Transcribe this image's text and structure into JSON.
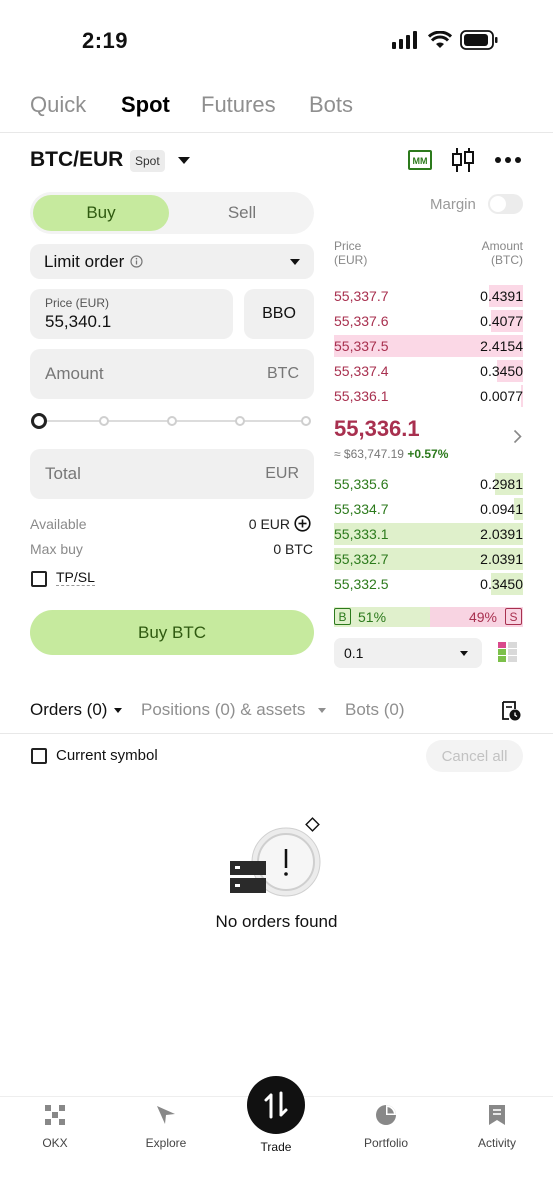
{
  "status_bar": {
    "time": "2:19"
  },
  "top_tabs": [
    {
      "label": "Quick"
    },
    {
      "label": "Spot"
    },
    {
      "label": "Futures"
    },
    {
      "label": "Bots"
    }
  ],
  "pair": {
    "name": "BTC/EUR",
    "badge": "Spot"
  },
  "order_form": {
    "buy_label": "Buy",
    "sell_label": "Sell",
    "order_type": "Limit order",
    "price_label": "Price (EUR)",
    "price_value": "55,340.1",
    "bbo_label": "BBO",
    "amount_placeholder": "Amount",
    "amount_unit": "BTC",
    "total_placeholder": "Total",
    "total_unit": "EUR",
    "available_label": "Available",
    "available_value": "0 EUR",
    "max_buy_label": "Max buy",
    "max_buy_value": "0 BTC",
    "tpsl_label": "TP/SL",
    "buy_button": "Buy BTC"
  },
  "order_book": {
    "margin_label": "Margin",
    "price_header": "Price\n(EUR)",
    "amount_header": "Amount\n(BTC)",
    "asks": [
      {
        "price": "55,337.7",
        "amount": "0.4391",
        "depth": 0.18
      },
      {
        "price": "55,337.6",
        "amount": "0.4077",
        "depth": 0.17
      },
      {
        "price": "55,337.5",
        "amount": "2.4154",
        "depth": 1.0
      },
      {
        "price": "55,337.4",
        "amount": "0.3450",
        "depth": 0.14
      },
      {
        "price": "55,336.1",
        "amount": "0.0077",
        "depth": 0.01
      }
    ],
    "mid_price": "55,336.1",
    "mid_fiat": "≈ $63,747.19",
    "mid_change": "+0.57%",
    "bids": [
      {
        "price": "55,335.6",
        "amount": "0.2981",
        "depth": 0.15
      },
      {
        "price": "55,334.7",
        "amount": "0.0941",
        "depth": 0.05
      },
      {
        "price": "55,333.1",
        "amount": "2.0391",
        "depth": 1.0
      },
      {
        "price": "55,332.7",
        "amount": "2.0391",
        "depth": 1.0
      },
      {
        "price": "55,332.5",
        "amount": "0.3450",
        "depth": 0.17
      }
    ],
    "buy_ratio_letter": "B",
    "buy_ratio": "51%",
    "sell_ratio": "49%",
    "sell_ratio_letter": "S",
    "precision": "0.1"
  },
  "orders_section": {
    "tabs": [
      {
        "label": "Orders (0)"
      },
      {
        "label": "Positions (0) & assets"
      },
      {
        "label": "Bots (0)"
      }
    ],
    "current_symbol_label": "Current symbol",
    "cancel_all_label": "Cancel all",
    "empty_text": "No orders found"
  },
  "bottom_nav": [
    {
      "label": "OKX",
      "icon": "okx-logo-icon"
    },
    {
      "label": "Explore",
      "icon": "compass-icon"
    },
    {
      "label": "Trade",
      "icon": "swap-arrows-icon"
    },
    {
      "label": "Portfolio",
      "icon": "pie-chart-icon"
    },
    {
      "label": "Activity",
      "icon": "bookmark-icon"
    }
  ],
  "colors": {
    "buy_green": "#c6ea9e",
    "ask_red": "#a8304f",
    "bid_green": "#2c7a1c",
    "ask_bar": "#fbd8e6",
    "bid_bar": "#dff0cb"
  }
}
